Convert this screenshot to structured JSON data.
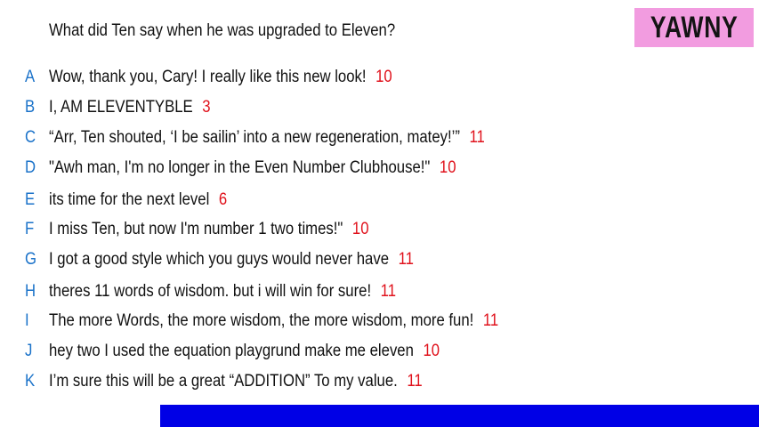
{
  "question": "What did Ten say when he was upgraded to Eleven?",
  "badge": "YAWNY",
  "colors": {
    "letter": "#1a72c9",
    "count": "#e0121c",
    "badge_bg": "#f29ce0",
    "bottom_bar": "#0000e6"
  },
  "answers": [
    {
      "letter": "A",
      "text": "Wow, thank you, Cary! I really like this new look!",
      "count": "10"
    },
    {
      "letter": "B",
      "text": "I, AM ELEVENTYBLE",
      "count": "3"
    },
    {
      "letter": "C",
      "text": "“Arr, Ten shouted, ‘I be sailin’ into a new regeneration, matey!’”",
      "count": "11"
    },
    {
      "letter": "D",
      "text": "\"Awh man, I'm no longer in the Even Number Clubhouse!\"",
      "count": "10"
    },
    {
      "letter": "E",
      "text": "its time for the next level",
      "count": "6"
    },
    {
      "letter": "F",
      "text": "I miss Ten,  but now I'm number 1 two times!\"",
      "count": "10"
    },
    {
      "letter": "G",
      "text": "I got a good style which you guys would never have",
      "count": "11"
    },
    {
      "letter": "H",
      "text": "theres 11 words of wisdom. but i will win for sure!",
      "count": "11"
    },
    {
      "letter": "I",
      "text": "The more Words, the more wisdom, the more wisdom, more fun!",
      "count": "11"
    },
    {
      "letter": "J",
      "text": "hey two I used the equation playgrund make me eleven",
      "count": "10"
    },
    {
      "letter": "K",
      "text": "I’m sure this will be a great “ADDITION” To my value.",
      "count": "11"
    }
  ]
}
